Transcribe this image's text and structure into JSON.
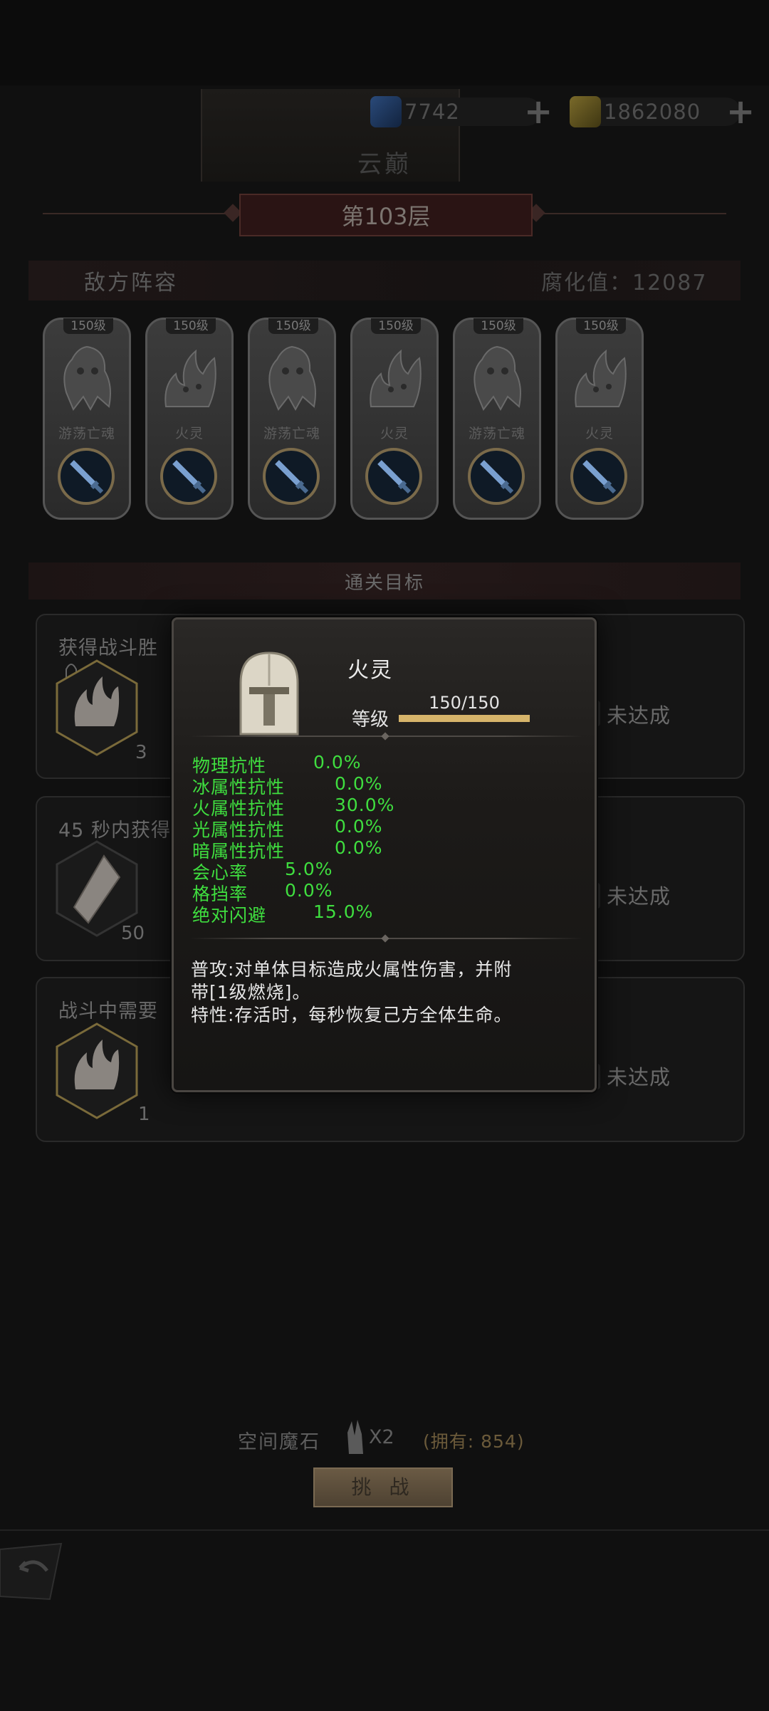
{
  "resources": {
    "blue_gem": "7742",
    "gold_gem": "1862080",
    "plus": "+"
  },
  "page_title": "云巅",
  "floor": "第103层",
  "enemy_section": {
    "title": "敌方阵容",
    "corruption": "腐化值：12087"
  },
  "enemies": [
    {
      "level": "150级",
      "name": "游荡亡魂"
    },
    {
      "level": "150级",
      "name": "火灵"
    },
    {
      "level": "150级",
      "name": "游荡亡魂"
    },
    {
      "level": "150级",
      "name": "火灵"
    },
    {
      "level": "150级",
      "name": "游荡亡魂"
    },
    {
      "level": "150级",
      "name": "火灵"
    }
  ],
  "goals_title": "通关目标",
  "goals": [
    {
      "text": "获得战斗胜",
      "reward_count": "3",
      "status": "未达成"
    },
    {
      "text": "45 秒内获得",
      "reward_count": "50",
      "status": "未达成"
    },
    {
      "text": "战斗中需要",
      "reward_count": "1",
      "status": "未达成"
    }
  ],
  "cost": {
    "label": "空间魔石",
    "multiplier": "X2",
    "owned": "(拥有: 854)"
  },
  "challenge_button": "挑 战",
  "tooltip": {
    "name": "火灵",
    "level_label": "等级",
    "level_value": "150/150",
    "level_progress": 1.0,
    "stats": [
      {
        "label": "物理抗性",
        "value": "0.0%"
      },
      {
        "label": "冰属性抗性",
        "value": "0.0%"
      },
      {
        "label": "火属性抗性",
        "value": "30.0%"
      },
      {
        "label": "光属性抗性",
        "value": "0.0%"
      },
      {
        "label": "暗属性抗性",
        "value": "0.0%"
      },
      {
        "label": "会心率",
        "value": "5.0%"
      },
      {
        "label": "格挡率",
        "value": "0.0%"
      },
      {
        "label": "绝对闪避",
        "value": "15.0%"
      }
    ],
    "desc_line1": "普攻:对单体目标造成火属性伤害，并附",
    "desc_line2": "带[1级燃烧]。",
    "desc_line3": "特性:存活时，每秒恢复己方全体生命。",
    "stat_color": "#3fde3f"
  }
}
